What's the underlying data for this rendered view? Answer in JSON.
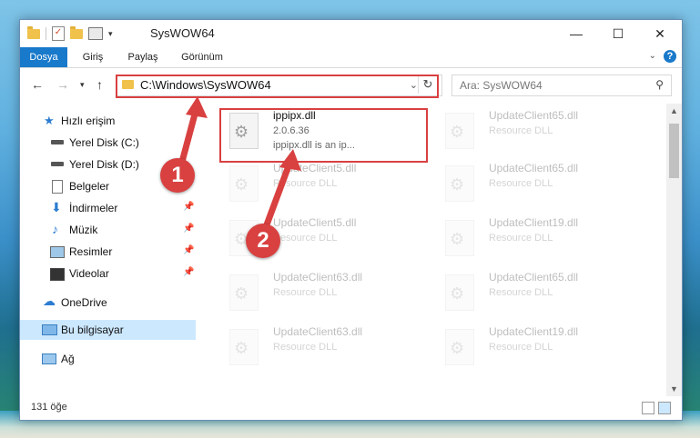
{
  "window": {
    "title": "SysWOW64"
  },
  "ribbon": {
    "tabs": [
      "Dosya",
      "Giriş",
      "Paylaş",
      "Görünüm"
    ],
    "active_tab": "Dosya"
  },
  "address": {
    "path": "C:\\Windows\\SysWOW64"
  },
  "search": {
    "placeholder": "Ara: SysWOW64"
  },
  "sidebar": {
    "items": [
      {
        "label": "Hızlı erişim",
        "icon": "star-icon"
      },
      {
        "label": "Yerel Disk (C:)",
        "icon": "drive-icon"
      },
      {
        "label": "Yerel Disk (D:)",
        "icon": "drive-icon"
      },
      {
        "label": "Belgeler",
        "icon": "document-icon"
      },
      {
        "label": "İndirmeler",
        "icon": "download-icon"
      },
      {
        "label": "Müzik",
        "icon": "music-icon"
      },
      {
        "label": "Resimler",
        "icon": "pictures-icon"
      },
      {
        "label": "Videolar",
        "icon": "video-icon"
      },
      {
        "label": "OneDrive",
        "icon": "cloud-icon"
      },
      {
        "label": "Bu bilgisayar",
        "icon": "computer-icon"
      },
      {
        "label": "Ağ",
        "icon": "network-icon"
      }
    ]
  },
  "files": [
    {
      "name": "ippipx.dll",
      "line2": "2.0.6.36",
      "line3": "ippipx.dll is an ip...",
      "highlighted": true
    },
    {
      "name": "UpdateClient65.dll",
      "line2": "Resource DLL"
    },
    {
      "name": "UpdateClient5.dll",
      "line2": "Resource DLL"
    },
    {
      "name": "UpdateClient65.dll",
      "line2": "Resource DLL"
    },
    {
      "name": "UpdateClient5.dll",
      "line2": "Resource DLL"
    },
    {
      "name": "UpdateClient19.dll",
      "line2": "Resource DLL"
    },
    {
      "name": "UpdateClient63.dll",
      "line2": "Resource DLL"
    },
    {
      "name": "UpdateClient65.dll",
      "line2": "Resource DLL"
    },
    {
      "name": "UpdateClient63.dll",
      "line2": "Resource DLL"
    },
    {
      "name": "UpdateClient19.dll",
      "line2": "Resource DLL"
    }
  ],
  "status": {
    "count": "131 öğe"
  },
  "annotations": {
    "step1": "1",
    "step2": "2"
  },
  "colors": {
    "accent": "#1979ca",
    "highlight": "#d94040",
    "selected": "#cce8ff"
  }
}
